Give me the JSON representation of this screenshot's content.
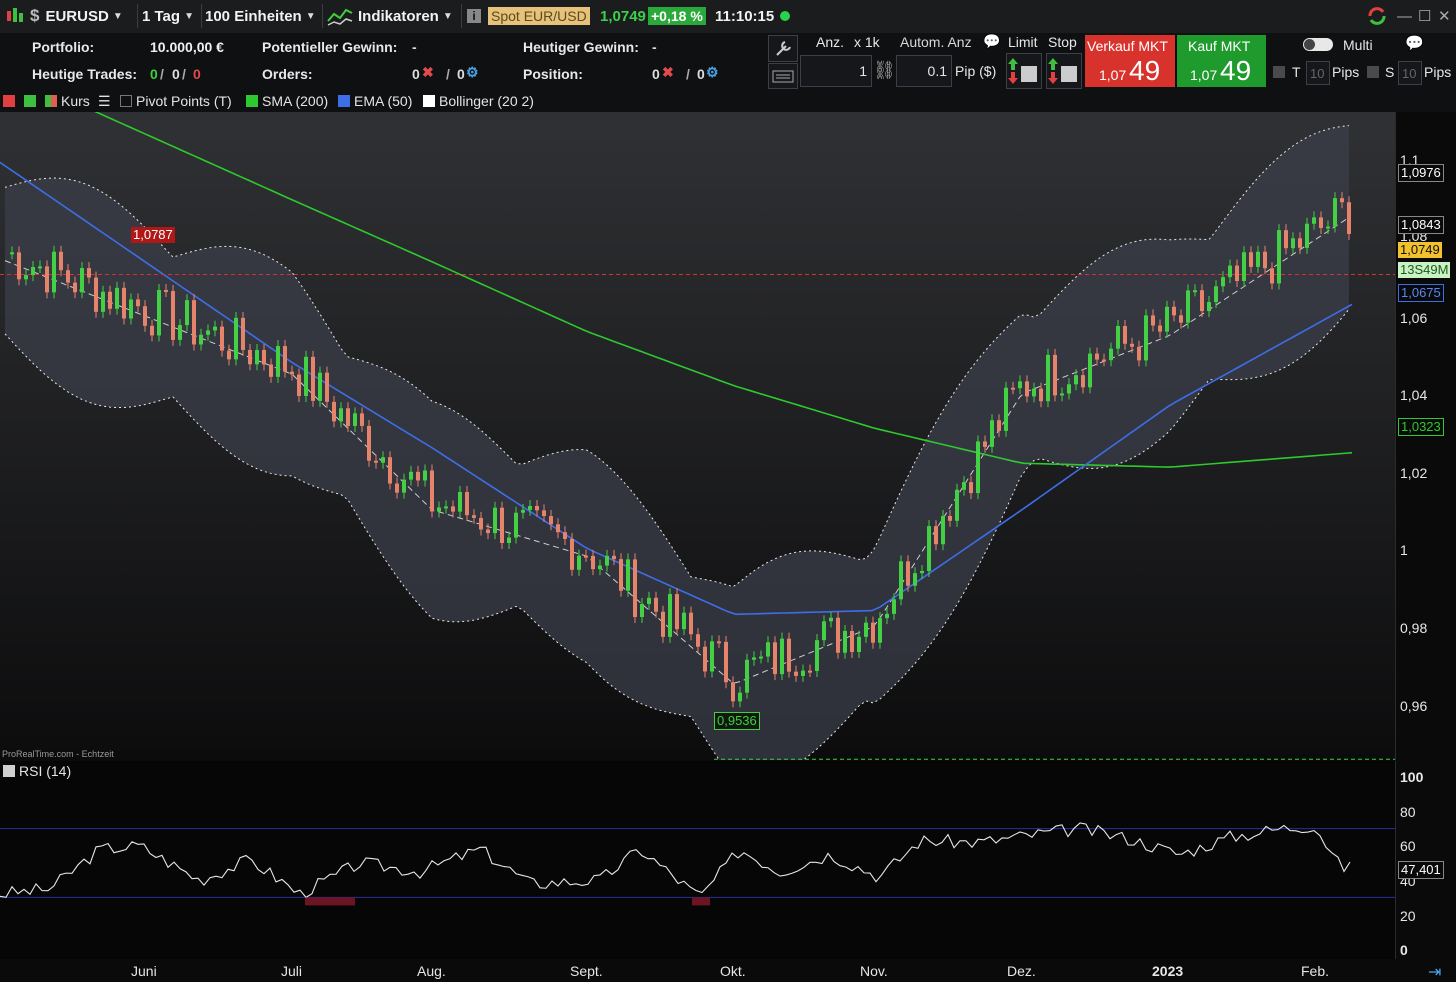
{
  "toolbar": {
    "symbol": "EURUSD",
    "timeframe": "1 Tag",
    "units": "100 Einheiten",
    "indicators": "Indikatoren",
    "instrument": "Spot EUR/USD",
    "price": "1,0749",
    "change": "+0,18 %",
    "time": "11:10:15",
    "status_color": "#2bd14a"
  },
  "info": {
    "portfolio_label": "Portfolio:",
    "portfolio_value": "10.000,00 €",
    "trades_label": "Heutige Trades:",
    "trades_values": [
      "0",
      "0",
      "0"
    ],
    "potential_label": "Potentieller Gewinn:",
    "potential_value": "-",
    "orders_label": "Orders:",
    "orders_a": "0",
    "orders_b": "0",
    "today_label": "Heutiger Gewinn:",
    "today_value": "-",
    "position_label": "Position:",
    "position_a": "0",
    "position_b": "0",
    "qty_label": "Anz.",
    "qty_mult": "x 1k",
    "qty_value": "1",
    "auto_label": "Autom. Anz",
    "pip_value": "0.1",
    "pip_unit": "Pip ($)",
    "limit_label": "Limit",
    "stop_label": "Stop",
    "sell_label": "Verkauf MKT",
    "sell_small": "1,07",
    "sell_big": "49",
    "buy_label": "Kauf MKT",
    "buy_small": "1,07",
    "buy_big": "49",
    "multi_label": "Multi",
    "t_label": "T",
    "t_value": "10",
    "t_unit": "Pips",
    "s_label": "S",
    "s_value": "10",
    "s_unit": "Pips"
  },
  "legend": {
    "price": "Kurs",
    "pivot": "Pivot Points (T)",
    "sma": "SMA (200)",
    "ema": "EMA (50)",
    "bollinger": "Bollinger (20 2)",
    "rsi": "RSI (14)",
    "source": "ProRealTime.com - Echtzeit"
  },
  "colors": {
    "up": "#44d044",
    "down": "#e6836b",
    "sma": "#2ec92e",
    "ema": "#3d6ee8",
    "band_fill": "#3b3d4a",
    "sell": "#d8322c",
    "buy": "#1f9b2e"
  },
  "chart_data": {
    "type": "line",
    "title": "EURUSD",
    "x": [
      "Juni",
      "Juli",
      "Aug.",
      "Sept.",
      "Okt.",
      "Nov.",
      "Dez.",
      "2023",
      "Feb."
    ],
    "ytick_labels": [
      "1,1",
      "1,08",
      "1,06",
      "1,04",
      "1,02",
      "1",
      "0,98",
      "0,96"
    ],
    "ylim": [
      0.95,
      1.1
    ],
    "series": [
      {
        "name": "Kurs",
        "values": [
          1.07,
          1.055,
          1.02,
          1.008,
          0.975,
          0.99,
          1.05,
          1.065,
          1.09
        ]
      },
      {
        "name": "SMA (200)",
        "values": [
          1.115,
          1.098,
          1.082,
          1.064,
          1.05,
          1.039,
          1.03,
          1.029,
          1.032
        ]
      },
      {
        "name": "EMA (50)",
        "values": [
          1.082,
          1.056,
          1.034,
          1.008,
          0.991,
          0.992,
          1.018,
          1.045,
          1.066
        ]
      }
    ],
    "tags": {
      "high_marker": "1,0787",
      "low_marker": "0,9536",
      "upper_band": "1,0976",
      "mid_level": "1,0843",
      "last_price": "1,0749",
      "countdown": "13S49M",
      "ema_value": "1,0675",
      "sma_value": "1,0323"
    },
    "rsi": {
      "name": "RSI (14)",
      "ytick_labels": [
        "100",
        "80",
        "60",
        "40",
        "20",
        "0"
      ],
      "ylim": [
        0,
        100
      ],
      "levels": [
        70,
        30
      ],
      "last": "47,401"
    }
  }
}
